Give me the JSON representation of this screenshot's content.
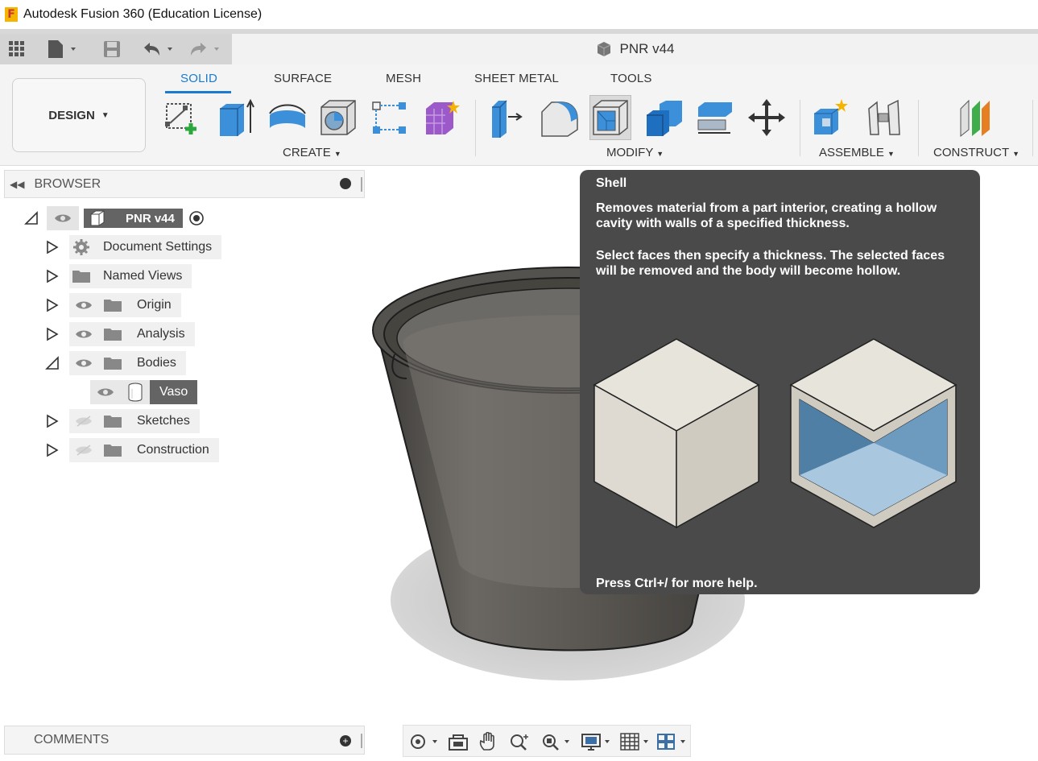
{
  "window": {
    "title": "Autodesk Fusion 360 (Education License)"
  },
  "document": {
    "name": "PNR v44"
  },
  "workspace": {
    "label": "DESIGN"
  },
  "tabs": [
    {
      "label": "SOLID"
    },
    {
      "label": "SURFACE"
    },
    {
      "label": "MESH"
    },
    {
      "label": "SHEET METAL"
    },
    {
      "label": "TOOLS"
    }
  ],
  "groups": {
    "create": "CREATE",
    "modify": "MODIFY",
    "assemble": "ASSEMBLE",
    "construct": "CONSTRUCT"
  },
  "browser": {
    "title": "BROWSER",
    "root": "PNR v44",
    "items": [
      {
        "label": "Document Settings"
      },
      {
        "label": "Named Views"
      },
      {
        "label": "Origin"
      },
      {
        "label": "Analysis"
      },
      {
        "label": "Bodies"
      },
      {
        "label": "Vaso"
      },
      {
        "label": "Sketches"
      },
      {
        "label": "Construction"
      }
    ]
  },
  "tooltip": {
    "title": "Shell",
    "para1": "Removes material from a part interior, creating a hollow cavity with walls of a specified thickness.",
    "para2": "Select faces then specify a thickness. The selected faces will be removed and the body will become hollow.",
    "help": "Press Ctrl+/ for more help."
  },
  "comments": {
    "title": "COMMENTS"
  },
  "colors": {
    "accent": "#1a7bd0",
    "tooltip_bg": "#4a4a4a",
    "selected": "#646464"
  }
}
